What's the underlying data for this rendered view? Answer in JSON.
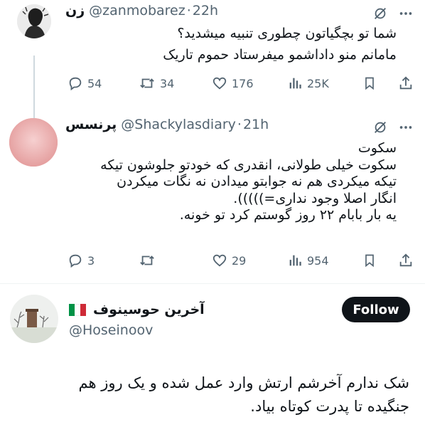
{
  "tweet1": {
    "name": "زن",
    "handle": "@zanmobarez",
    "sep": "·",
    "time": "22h",
    "lines": [
      "شما تو بچگیاتون چطوری تنبیه میشدید؟",
      "مامانم منو داداشمو میفرستاد حموم تاریک"
    ],
    "replies": "54",
    "retweets": "34",
    "likes": "176",
    "views": "25K"
  },
  "tweet2": {
    "name": "پرنسس",
    "handle": "@Shackylasdiary",
    "sep": "·",
    "time": "21h",
    "lines": [
      "سکوت",
      "سکوت خیلی طولانی، انقدری که خودتو جلوشون تیکه",
      "تیکه میکردی هم نه جوابتو میدادن نه نگات میکردن",
      "انگار اصلا وجود نداری=))))).",
      "یه بار بابام ۲۲ روز گوستم کرد تو خونه."
    ],
    "replies": "3",
    "retweets": "",
    "likes": "29",
    "views": "954"
  },
  "tweet3": {
    "name": "آخرین حوسینوف",
    "flag": "Italy flag",
    "handle": "@Hoseinoov",
    "follow_label": "Follow",
    "lines": [
      "شک ندارم آخرشم ارتش وارد عمل شده و یک روز هم",
      "جنگیده تا پدرت کوتاه بیاد."
    ]
  },
  "colors": {
    "text": "#0f1419",
    "muted": "#536471",
    "line": "#cfd9de",
    "follow_bg": "#0f1419"
  },
  "icons": [
    "grok-icon",
    "more-icon",
    "reply-icon",
    "retweet-icon",
    "like-icon",
    "views-icon",
    "bookmark-icon",
    "share-icon"
  ]
}
